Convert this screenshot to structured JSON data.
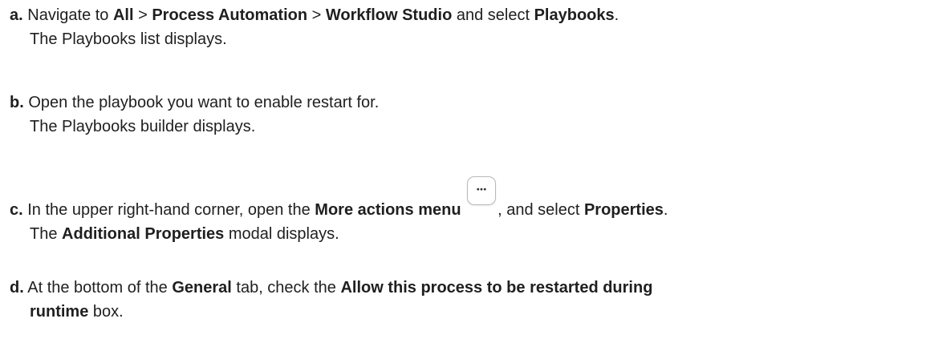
{
  "steps": [
    {
      "letter": "a.",
      "line1": [
        {
          "text": "Navigate to ",
          "bold": false
        },
        {
          "text": "All",
          "bold": true
        },
        {
          "text": " > ",
          "bold": false
        },
        {
          "text": "Process Automation",
          "bold": true
        },
        {
          "text": " > ",
          "bold": false
        },
        {
          "text": "Workflow Studio",
          "bold": true
        },
        {
          "text": " and select ",
          "bold": false
        },
        {
          "text": "Playbooks",
          "bold": true
        },
        {
          "text": ".",
          "bold": false
        }
      ],
      "result": "The Playbooks list displays."
    },
    {
      "letter": "b.",
      "line1": [
        {
          "text": "Open the playbook you want to enable restart for.",
          "bold": false
        }
      ],
      "result": "The Playbooks builder displays."
    },
    {
      "letter": "c.",
      "line1_before": "In the upper right-hand corner, open the ",
      "line1_bold": "More actions menu",
      "line1_mid": ", and select ",
      "line1_bold2": "Properties",
      "line1_end": ".",
      "result_prefix": "The ",
      "result_bold": "Additional Properties",
      "result_suffix": " modal displays."
    },
    {
      "letter": "d.",
      "part1": "At the bottom of the ",
      "bold1": "General",
      "part2": " tab, check the ",
      "bold2_line1": "Allow this process to be restarted during",
      "bold2_line2": "runtime",
      "part3": " box."
    }
  ],
  "icons": {
    "more_actions": "ellipsis-icon"
  }
}
